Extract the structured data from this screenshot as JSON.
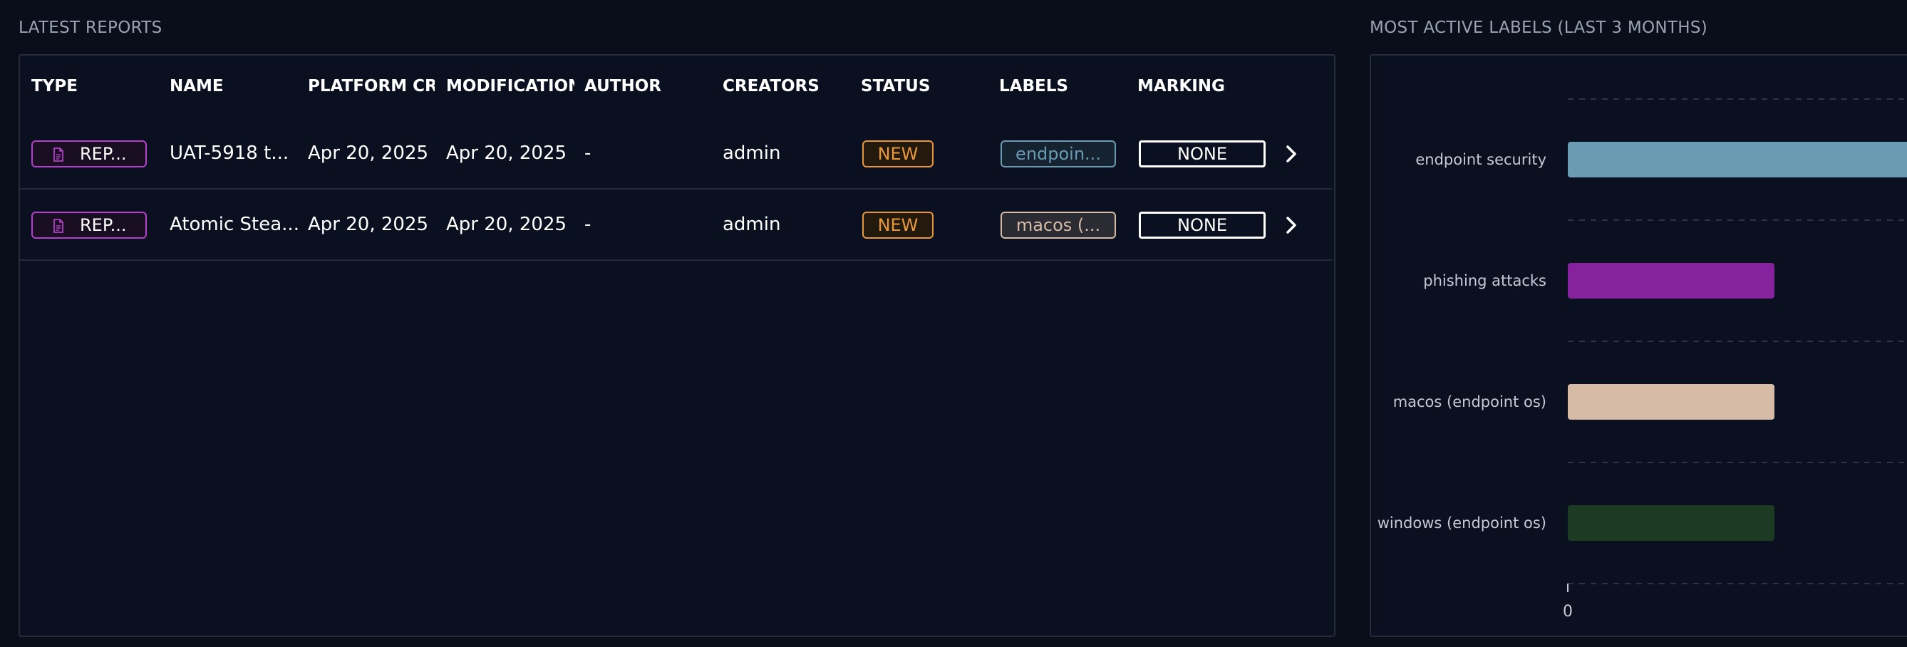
{
  "reports": {
    "title": "LATEST REPORTS",
    "columns": [
      "TYPE",
      "NAME",
      "PLATFORM CREA",
      "MODIFICATION",
      "AUTHOR",
      "CREATORS",
      "STATUS",
      "LABELS",
      "MARKING"
    ],
    "rows": [
      {
        "type": "REP...",
        "name": "UAT-5918 t...",
        "platform_created": "Apr 20, 2025",
        "modification": "Apr 20, 2025",
        "author": "-",
        "creators": "admin",
        "status": "NEW",
        "label": "endpoin...",
        "marking": "NONE"
      },
      {
        "type": "REP...",
        "name": "Atomic Stea...",
        "platform_created": "Apr 20, 2025",
        "modification": "Apr 20, 2025",
        "author": "-",
        "creators": "admin",
        "status": "NEW",
        "label": "macos (...",
        "marking": "NONE"
      }
    ],
    "icons": {
      "type": "document-icon",
      "row_action": "chevron-right-icon"
    },
    "colors": {
      "report": "#b43fcc",
      "status_new": "#e8973a",
      "label_endpoint": "#6a9bb3",
      "label_macos": "#d6bba7"
    }
  },
  "labels_chart": {
    "title": "MOST ACTIVE LABELS (LAST 3 MONTHS)"
  },
  "chart_data": {
    "type": "bar",
    "orientation": "horizontal",
    "categories": [
      "endpoint security",
      "phishing attacks",
      "macos (endpoint os)",
      "windows (endpoint os)"
    ],
    "values": [
      2,
      1,
      1,
      1
    ],
    "colors": [
      "#6a9bb3",
      "#84239b",
      "#d6bba7",
      "#1d3a22"
    ],
    "xticks": [
      "0"
    ],
    "xlim": [
      0,
      2
    ],
    "grid": true
  }
}
